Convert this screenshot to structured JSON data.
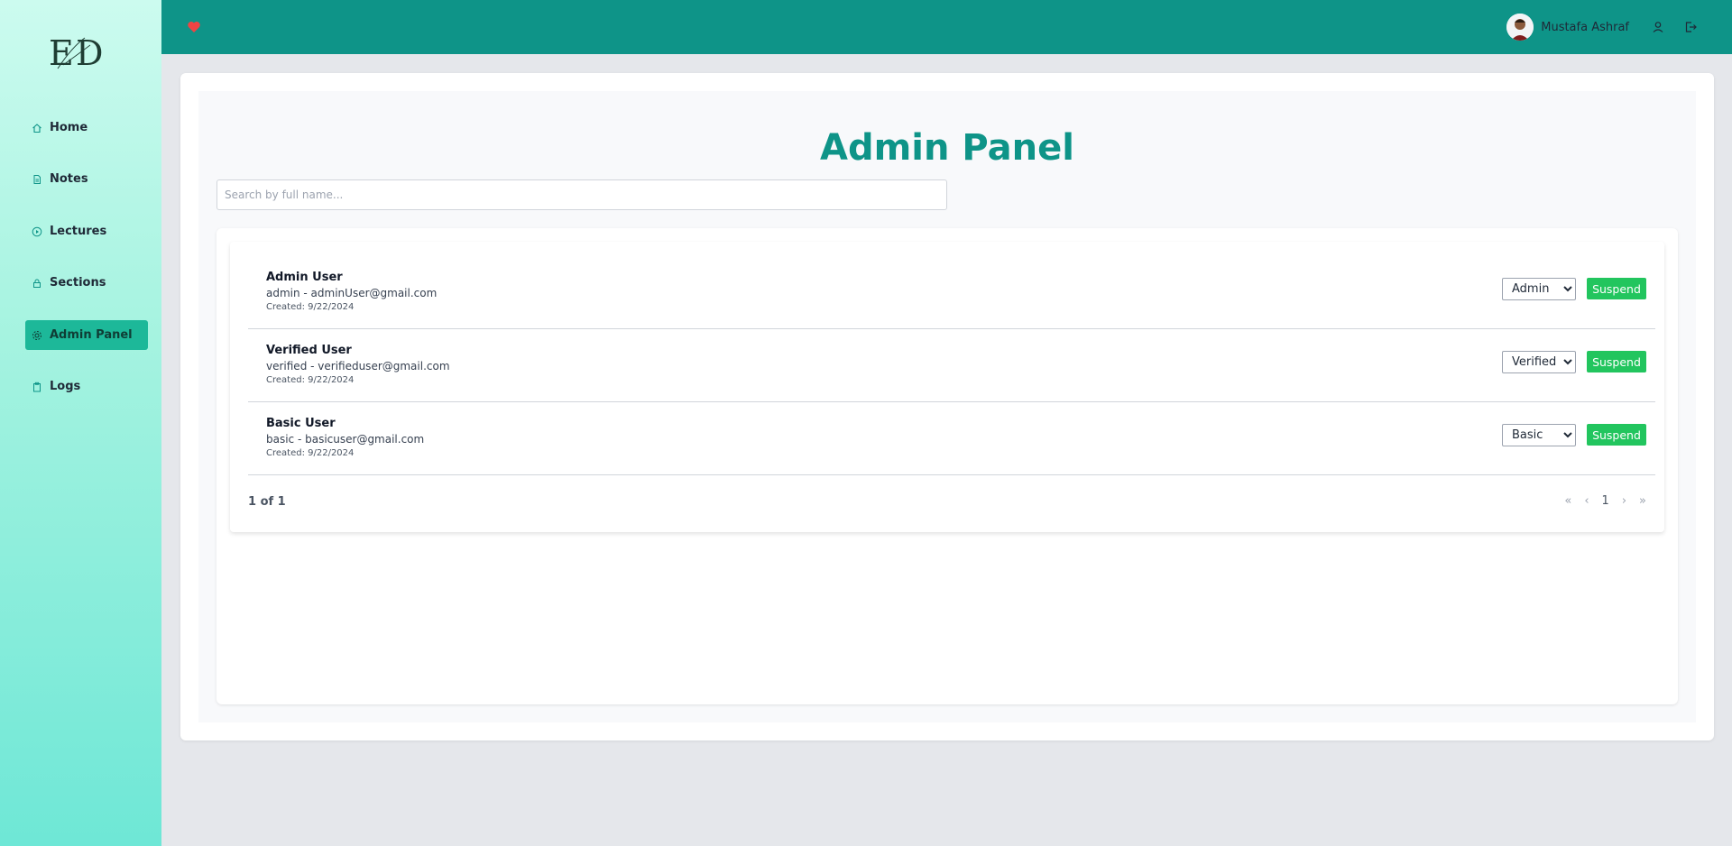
{
  "sidebar": {
    "items": [
      {
        "label": "Home",
        "icon": "home-icon"
      },
      {
        "label": "Notes",
        "icon": "file-icon"
      },
      {
        "label": "Lectures",
        "icon": "play-circle-icon"
      },
      {
        "label": "Sections",
        "icon": "lock-icon"
      },
      {
        "label": "Admin Panel",
        "icon": "gear-icon",
        "active": true
      },
      {
        "label": "Logs",
        "icon": "clipboard-icon"
      }
    ]
  },
  "topbar": {
    "user_name": "Mustafa Ashraf",
    "heart_color": "#ef4444",
    "bar_color": "#0e9488"
  },
  "main": {
    "title": "Admin Panel",
    "search_placeholder": "Search by full name...",
    "users": [
      {
        "name": "Admin User",
        "meta": "admin - adminUser@gmail.com",
        "created": "Created: 9/22/2024",
        "role": "Admin",
        "action": "Suspend"
      },
      {
        "name": "Verified User",
        "meta": "verified - verifieduser@gmail.com",
        "created": "Created: 9/22/2024",
        "role": "Verified",
        "action": "Suspend"
      },
      {
        "name": "Basic User",
        "meta": "basic - basicuser@gmail.com",
        "created": "Created: 9/22/2024",
        "role": "Basic",
        "action": "Suspend"
      }
    ],
    "pager": {
      "status": "1 of 1",
      "first": "«",
      "prev": "‹",
      "page": "1",
      "next": "›",
      "last": "»"
    }
  }
}
